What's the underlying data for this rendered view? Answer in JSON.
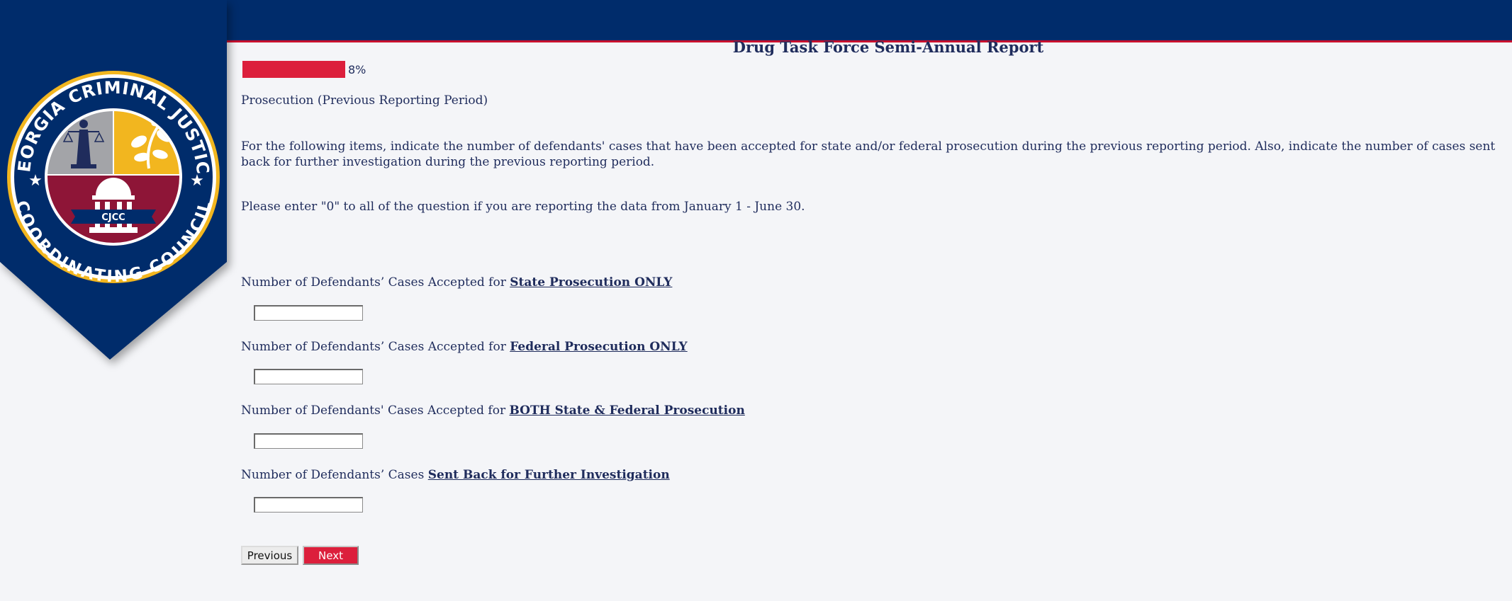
{
  "page": {
    "title": "Drug Task Force Semi-Annual Report",
    "progress_text": "8%",
    "progress_fraction": 0.08
  },
  "logo": {
    "top_text": "GEORGIA CRIMINAL JUSTICE",
    "bottom_text": "COORDINATING COUNCIL",
    "ribbon_text": "CJCC",
    "colors": {
      "navy": "#002c6b",
      "gold": "#f2b61f",
      "gray": "#a3a4a8",
      "maroon": "#8e1537",
      "red": "#dc1f3c"
    }
  },
  "section": {
    "title": "Prosecution (Previous Reporting Period)",
    "instructions": "For the following items, indicate the number of defendants' cases that have been accepted for state and/or federal prosecution during the previous reporting period. Also, indicate the number of cases sent back for further investigation during the previous reporting period.",
    "note": "Please enter \"0\" to all of the question if you are reporting the data from January 1 - June 30."
  },
  "questions": [
    {
      "prefix": "Number of Defendants’ Cases Accepted for ",
      "emphasis": "State Prosecution ONLY",
      "value": ""
    },
    {
      "prefix": "Number of Defendants’ Cases Accepted for ",
      "emphasis": "Federal Prosecution ONLY",
      "value": ""
    },
    {
      "prefix": "Number of Defendants' Cases Accepted for ",
      "emphasis": "BOTH State & Federal Prosecution",
      "value": ""
    },
    {
      "prefix": "Number of Defendants’ Cases ",
      "emphasis": "Sent Back for Further Investigation",
      "value": ""
    }
  ],
  "buttons": {
    "previous": "Previous",
    "next": "Next"
  }
}
